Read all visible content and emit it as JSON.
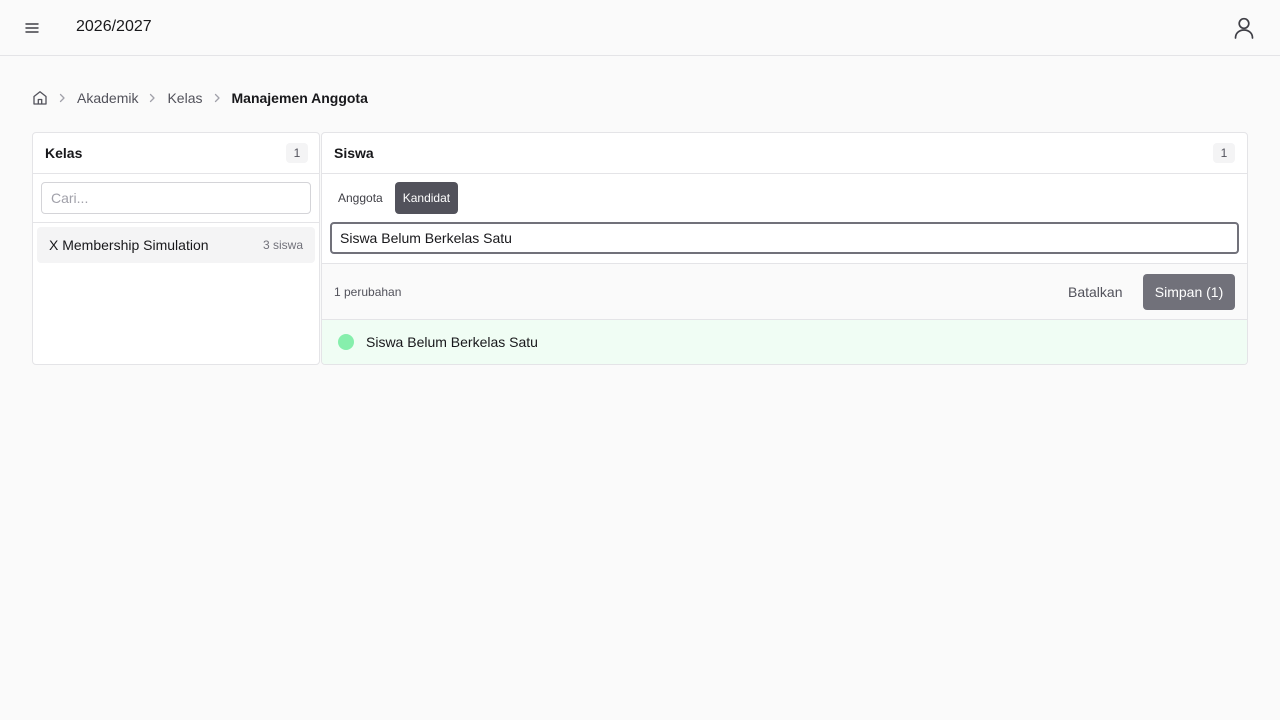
{
  "header": {
    "menu_icon": "hamburger-menu-icon",
    "title": "2026/2027",
    "user_icon": "user-icon"
  },
  "breadcrumb": {
    "home_icon": "home-icon",
    "items": [
      "Akademik",
      "Kelas"
    ],
    "current": "Manajemen Anggota"
  },
  "class_panel": {
    "title": "Kelas",
    "count": "1",
    "search_placeholder": "Cari...",
    "items": [
      {
        "name": "X Membership Simulation",
        "count": "3 siswa"
      }
    ]
  },
  "student_panel": {
    "title": "Siswa",
    "count": "1",
    "tabs": [
      {
        "label": "Anggota",
        "active": false
      },
      {
        "label": "Kandidat",
        "active": true
      }
    ],
    "search_value": "Siswa Belum Berkelas Satu",
    "changes_text": "1 perubahan",
    "cancel_label": "Batalkan",
    "save_label": "Simpan (1)",
    "students": [
      {
        "name": "Siswa Belum Berkelas Satu",
        "status_color": "#86efac"
      }
    ]
  },
  "colors": {
    "accent": "#52525b",
    "save_button": "#71717a",
    "selected_row": "#f0fdf4"
  }
}
